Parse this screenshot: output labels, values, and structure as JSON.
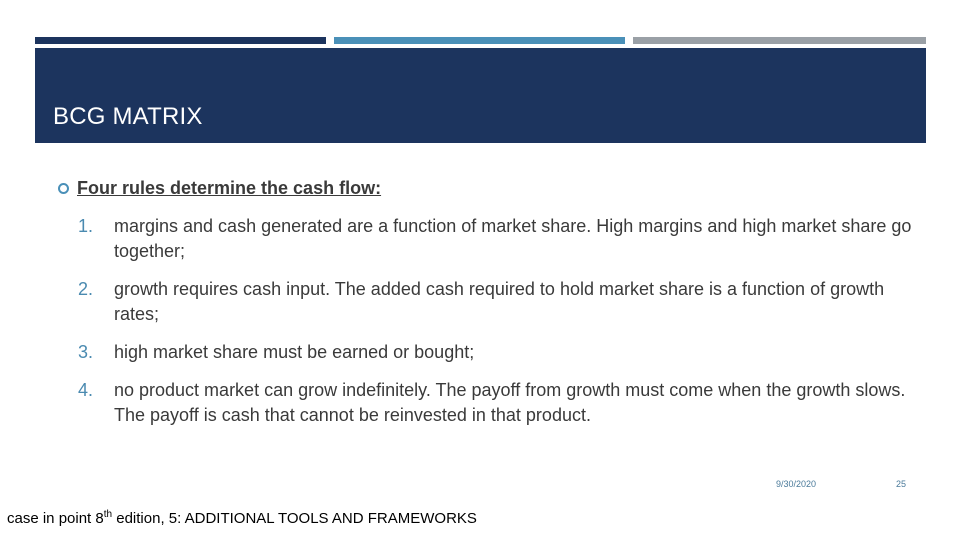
{
  "slide": {
    "title": "BCG MATRIX",
    "lead": "Four rules determine the cash flow:",
    "items": [
      {
        "num": "1.",
        "text": "margins and cash generated are a function of market share. High margins and high market share go together;"
      },
      {
        "num": "2.",
        "text": "growth requires cash input. The added cash required to hold market share is a function of growth rates;"
      },
      {
        "num": "3.",
        "text": "high market share must be earned or bought;"
      },
      {
        "num": "4.",
        "text": "no product market can grow indefinitely. The payoff from growth must come when the growth slows. The payoff is cash that cannot be reinvested in that product."
      }
    ],
    "date": "9/30/2020",
    "page": "25"
  },
  "caption": {
    "prefix": "case in point 8",
    "sup": "th",
    "suffix": " edition, 5: ADDITIONAL TOOLS AND FRAMEWORKS"
  },
  "colors": {
    "navy": "#1c345e",
    "blue": "#4a90b8",
    "gray": "#9aa0a6"
  }
}
